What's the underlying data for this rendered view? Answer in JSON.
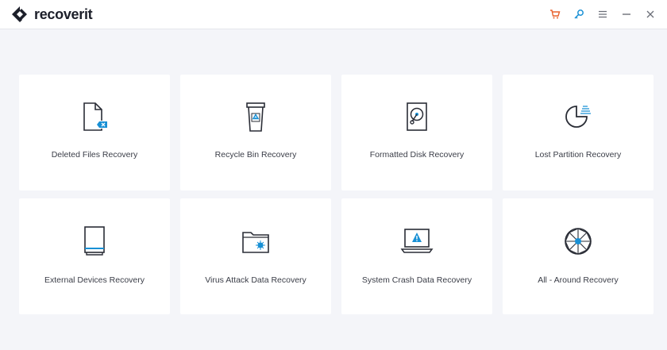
{
  "app": {
    "name": "recoverit",
    "brand_color": "#1c1f2a",
    "accent_color": "#1890d5",
    "cart_color": "#e8612c"
  },
  "titlebar": {
    "controls": [
      {
        "icon": "cart-icon"
      },
      {
        "icon": "key-icon"
      },
      {
        "icon": "menu-icon"
      },
      {
        "icon": "minimize-icon"
      },
      {
        "icon": "close-icon"
      }
    ]
  },
  "modes": [
    {
      "label": "Deleted Files Recovery",
      "icon": "deleted-file-icon"
    },
    {
      "label": "Recycle Bin Recovery",
      "icon": "recycle-bin-icon"
    },
    {
      "label": "Formatted Disk Recovery",
      "icon": "formatted-disk-icon"
    },
    {
      "label": "Lost Partition Recovery",
      "icon": "lost-partition-icon"
    },
    {
      "label": "External Devices Recovery",
      "icon": "external-device-icon"
    },
    {
      "label": "Virus Attack Data Recovery",
      "icon": "virus-folder-icon"
    },
    {
      "label": "System Crash Data Recovery",
      "icon": "system-crash-icon"
    },
    {
      "label": "All - Around Recovery",
      "icon": "all-around-icon"
    }
  ]
}
